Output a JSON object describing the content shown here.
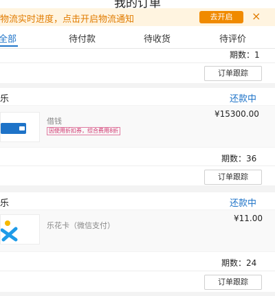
{
  "header": {
    "title": "我的订单"
  },
  "banner": {
    "text": "物流实时进度，点击开启物流通知",
    "button": "去开启",
    "close_icon": "×"
  },
  "tabs": [
    {
      "label": "全部",
      "active": true
    },
    {
      "label": "待付款",
      "active": false
    },
    {
      "label": "待收货",
      "active": false
    },
    {
      "label": "待评价",
      "active": false
    }
  ],
  "orders": [
    {
      "period": "期数：1",
      "track_label": "订单跟踪"
    },
    {
      "shop": "乐",
      "status": "还款中",
      "item_name": "借钱",
      "item_tag": "因使用折扣券，综合费用8折",
      "price": "¥15300.00",
      "period": "期数：36",
      "track_label": "订单跟踪",
      "icon": "wallet-icon"
    },
    {
      "shop": "乐",
      "status": "还款中",
      "item_name": "乐花卡（微信支付）",
      "price": "¥11.00",
      "period": "期数：24",
      "track_label": "订单跟踪",
      "icon": "lehua-card-icon"
    }
  ],
  "colors": {
    "accent": "#1e73c8",
    "banner_bg": "#fff4e0",
    "banner_text": "#e07b00",
    "button_orange": "#f08a00"
  }
}
